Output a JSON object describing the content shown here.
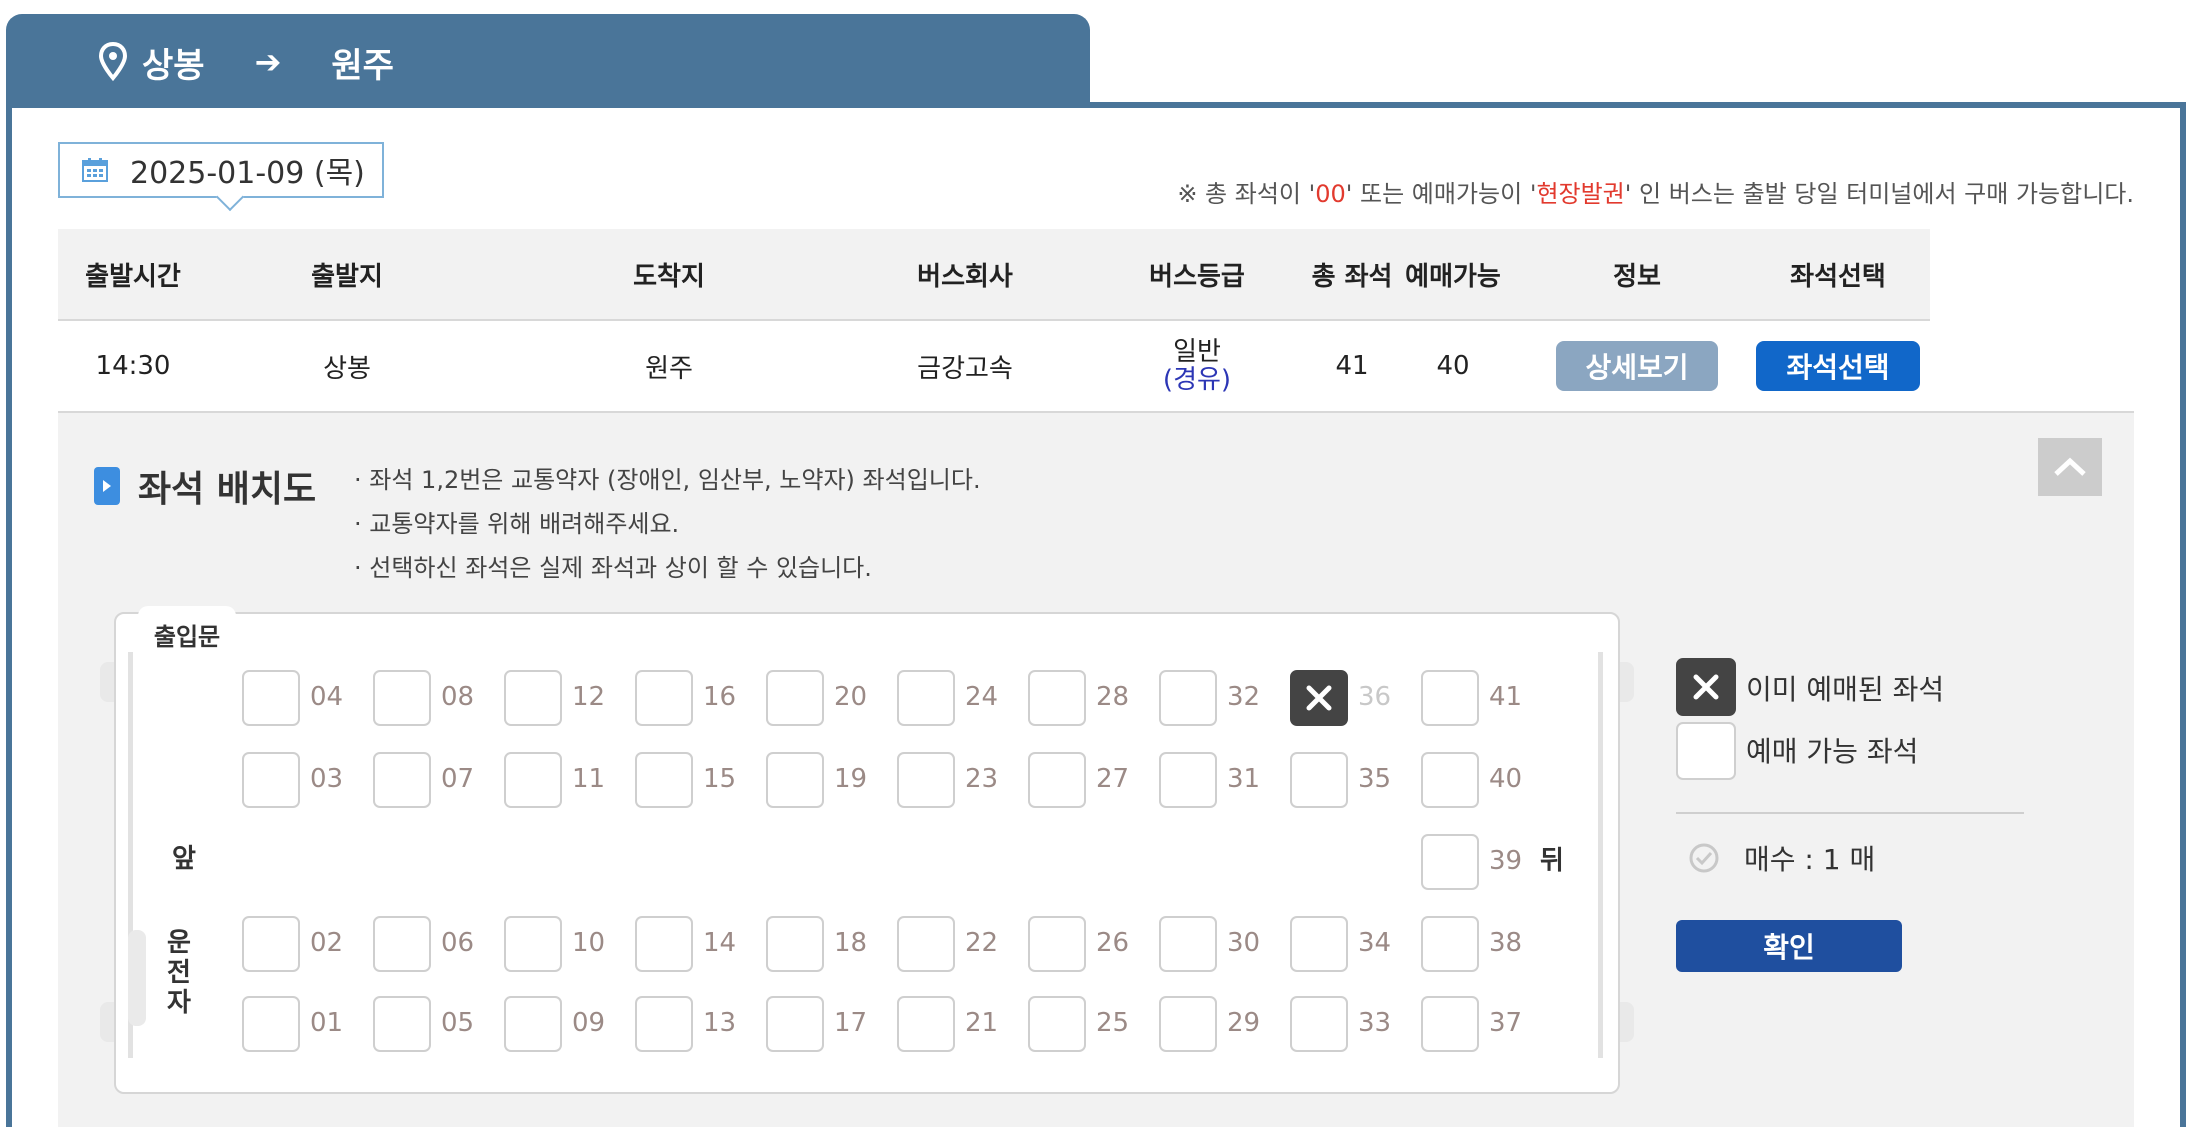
{
  "route": {
    "from": "상봉",
    "arrow": "➔",
    "to": "원주"
  },
  "date": "2025-01-09 (목)",
  "notice": {
    "prefix": "※ 총 좌석이 '",
    "code": "00",
    "middle": "' 또는 예매가능이 '",
    "keyword": "현장발권",
    "suffix": "' 인 버스는 출발 당일 터미널에서 구매 가능합니다."
  },
  "table": {
    "headers": [
      "출발시간",
      "출발지",
      "도착지",
      "버스회사",
      "버스등급",
      "총 좌석",
      "예매가능",
      "정보",
      "좌석선택"
    ],
    "row": {
      "time": "14:30",
      "from": "상봉",
      "to": "원주",
      "company": "금강고속",
      "grade": "일반",
      "via": "(경유)",
      "total": "41",
      "available": "40",
      "detail_label": "상세보기",
      "select_label": "좌석선택"
    }
  },
  "seatmap": {
    "title": "좌석 배치도",
    "notes": [
      "· 좌석 1,2번은 교통약자 (장애인, 임산부, 노약자) 좌석입니다.",
      "· 교통약자를 위해 배려해주세요.",
      "· 선택하신 좌석은 실제 좌석과 상이 할 수 있습니다."
    ],
    "door": "출입문",
    "front": "앞",
    "back": "뒤",
    "driver": [
      "운",
      "전",
      "자"
    ],
    "rows": [
      [
        "04",
        "08",
        "12",
        "16",
        "20",
        "24",
        "28",
        "32",
        "36",
        "41"
      ],
      [
        "03",
        "07",
        "11",
        "15",
        "19",
        "23",
        "27",
        "31",
        "35",
        "40"
      ],
      [
        "39"
      ],
      [
        "02",
        "06",
        "10",
        "14",
        "18",
        "22",
        "26",
        "30",
        "34",
        "38"
      ],
      [
        "01",
        "05",
        "09",
        "13",
        "17",
        "21",
        "25",
        "29",
        "33",
        "37"
      ]
    ],
    "sold": [
      "36"
    ]
  },
  "legend": {
    "sold": "이미 예매된 좌석",
    "available": "예매 가능 좌석"
  },
  "count": "매수 : 1 매",
  "confirm_label": "확인",
  "colors": {
    "header_blue": "#4a7599",
    "select_blue": "#1167c9",
    "confirm_blue": "#1f4f9f",
    "sold_gray": "#444444",
    "notice_red": "#e23a2e"
  }
}
